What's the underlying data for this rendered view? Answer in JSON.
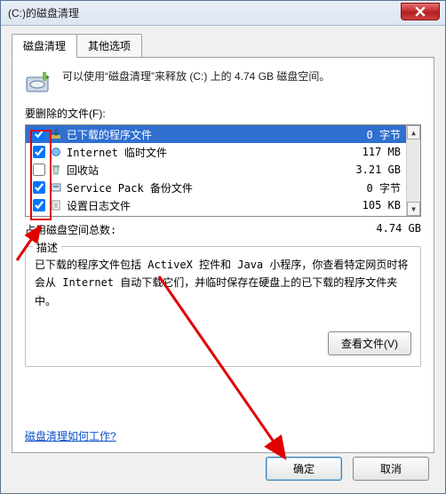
{
  "window": {
    "title": "(C:)的磁盘清理"
  },
  "tabs": {
    "cleanup": "磁盘清理",
    "other": "其他选项"
  },
  "intro": "可以使用“磁盘清理”来释放  (C:) 上的 4.74 GB 磁盘空间。",
  "files_label": "要删除的文件(F):",
  "files": [
    {
      "checked": true,
      "name": "已下载的程序文件",
      "size": "0 字节",
      "selected": true,
      "icon": "download"
    },
    {
      "checked": true,
      "name": "Internet 临时文件",
      "size": "117 MB",
      "selected": false,
      "icon": "ie"
    },
    {
      "checked": false,
      "name": "回收站",
      "size": "3.21 GB",
      "selected": false,
      "icon": "recycle"
    },
    {
      "checked": true,
      "name": "Service Pack 备份文件",
      "size": "0 字节",
      "selected": false,
      "icon": "sp"
    },
    {
      "checked": true,
      "name": "设置日志文件",
      "size": "105 KB",
      "selected": false,
      "icon": "log"
    }
  ],
  "total": {
    "label": "占用磁盘空间总数:",
    "value": "4.74 GB"
  },
  "desc": {
    "legend": "描述",
    "text": "已下载的程序文件包括 ActiveX 控件和 Java 小程序，你查看特定网页时将会从 Internet 自动下载它们，并临时保存在硬盘上的已下载的程序文件夹中。"
  },
  "view_button": "查看文件(V)",
  "help_link": "磁盘清理如何工作?",
  "footer": {
    "ok": "确定",
    "cancel": "取消"
  }
}
